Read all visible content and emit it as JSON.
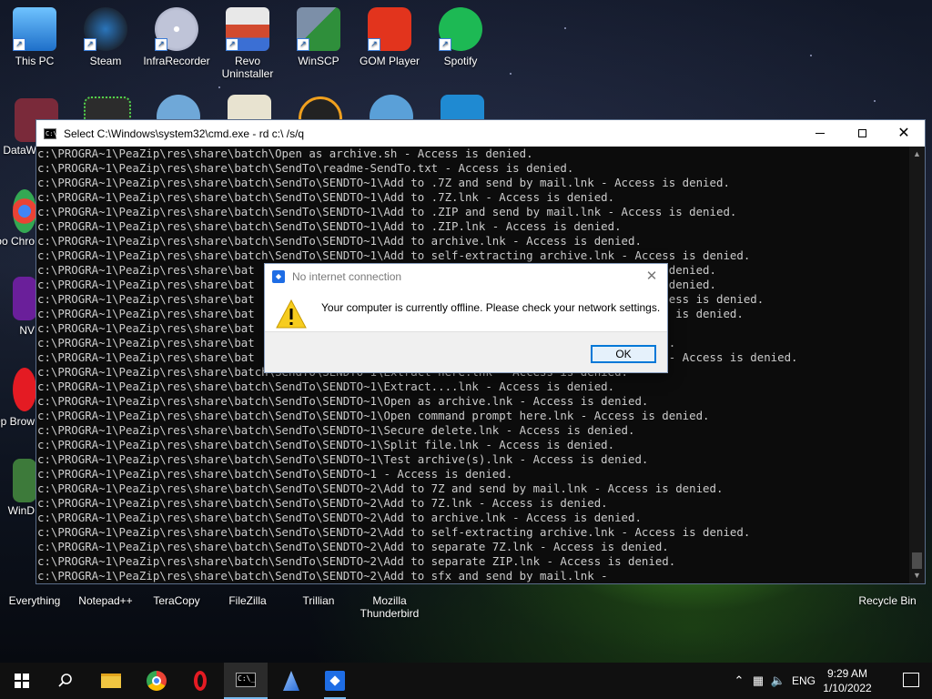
{
  "desktop": {
    "top_icons": [
      {
        "label": "This PC",
        "icon": "computer-icon",
        "color": "#3aa0e6"
      },
      {
        "label": "Steam",
        "icon": "steam-icon",
        "color": "#1b2838"
      },
      {
        "label": "InfraRecorder",
        "icon": "cd-icon",
        "color": "#c8c8d6"
      },
      {
        "label": "Revo Uninstaller",
        "icon": "uninstaller-icon",
        "color": "#d24a2f"
      },
      {
        "label": "WinSCP",
        "icon": "winscp-icon",
        "color": "#2f8f3b"
      },
      {
        "label": "GOM Player",
        "icon": "gom-player-icon",
        "color": "#e2341d"
      },
      {
        "label": "Spotify",
        "icon": "spotify-icon",
        "color": "#1db954"
      }
    ],
    "left_icons_partial": [
      "DataW",
      "Goo Chro",
      "NV",
      "Op Brow",
      "WinD"
    ],
    "bottom_icons": [
      {
        "label": "Everything",
        "icon": "search-app-icon"
      },
      {
        "label": "Notepad++",
        "icon": "notepad-icon"
      },
      {
        "label": "TeraCopy",
        "icon": "teracopy-icon"
      },
      {
        "label": "FileZilla",
        "icon": "filezilla-icon"
      },
      {
        "label": "Trillian",
        "icon": "trillian-icon"
      },
      {
        "label": "Mozilla Thunderbird",
        "icon": "thunderbird-icon"
      }
    ],
    "recycle_bin": "Recycle Bin"
  },
  "console": {
    "title": "Select C:\\Windows\\system32\\cmd.exe - rd  c:\\ /s/q",
    "lines": [
      "c:\\PROGRA~1\\PeaZip\\res\\share\\batch\\Open as archive.sh - Access is denied.",
      "c:\\PROGRA~1\\PeaZip\\res\\share\\batch\\SendTo\\readme-SendTo.txt - Access is denied.",
      "c:\\PROGRA~1\\PeaZip\\res\\share\\batch\\SendTo\\SENDTO~1\\Add to .7Z and send by mail.lnk - Access is denied.",
      "c:\\PROGRA~1\\PeaZip\\res\\share\\batch\\SendTo\\SENDTO~1\\Add to .7Z.lnk - Access is denied.",
      "c:\\PROGRA~1\\PeaZip\\res\\share\\batch\\SendTo\\SENDTO~1\\Add to .ZIP and send by mail.lnk - Access is denied.",
      "c:\\PROGRA~1\\PeaZip\\res\\share\\batch\\SendTo\\SENDTO~1\\Add to .ZIP.lnk - Access is denied.",
      "c:\\PROGRA~1\\PeaZip\\res\\share\\batch\\SendTo\\SENDTO~1\\Add to archive.lnk - Access is denied.",
      "c:\\PROGRA~1\\PeaZip\\res\\share\\batch\\SendTo\\SENDTO~1\\Add to self-extracting archive.lnk - Access is denied.",
      "c:\\PROGRA~1\\PeaZip\\res\\share\\bat                                                             denied.",
      "c:\\PROGRA~1\\PeaZip\\res\\share\\bat                                                             denied.",
      "c:\\PROGRA~1\\PeaZip\\res\\share\\bat                                                             ess is denied.",
      "c:\\PROGRA~1\\PeaZip\\res\\share\\bat                                                              is denied.",
      "c:\\PROGRA~1\\PeaZip\\res\\share\\bat",
      "c:\\PROGRA~1\\PeaZip\\res\\share\\bat                                                             .",
      "c:\\PROGRA~1\\PeaZip\\res\\share\\bat                                                             - Access is denied.",
      "c:\\PROGRA~1\\PeaZip\\res\\share\\batch\\SendTo\\SENDTO~1\\Extract here.lnk - Access is denied.",
      "c:\\PROGRA~1\\PeaZip\\res\\share\\batch\\SendTo\\SENDTO~1\\Extract....lnk - Access is denied.",
      "c:\\PROGRA~1\\PeaZip\\res\\share\\batch\\SendTo\\SENDTO~1\\Open as archive.lnk - Access is denied.",
      "c:\\PROGRA~1\\PeaZip\\res\\share\\batch\\SendTo\\SENDTO~1\\Open command prompt here.lnk - Access is denied.",
      "c:\\PROGRA~1\\PeaZip\\res\\share\\batch\\SendTo\\SENDTO~1\\Secure delete.lnk - Access is denied.",
      "c:\\PROGRA~1\\PeaZip\\res\\share\\batch\\SendTo\\SENDTO~1\\Split file.lnk - Access is denied.",
      "c:\\PROGRA~1\\PeaZip\\res\\share\\batch\\SendTo\\SENDTO~1\\Test archive(s).lnk - Access is denied.",
      "c:\\PROGRA~1\\PeaZip\\res\\share\\batch\\SendTo\\SENDTO~1 - Access is denied.",
      "c:\\PROGRA~1\\PeaZip\\res\\share\\batch\\SendTo\\SENDTO~2\\Add to 7Z and send by mail.lnk - Access is denied.",
      "c:\\PROGRA~1\\PeaZip\\res\\share\\batch\\SendTo\\SENDTO~2\\Add to 7Z.lnk - Access is denied.",
      "c:\\PROGRA~1\\PeaZip\\res\\share\\batch\\SendTo\\SENDTO~2\\Add to archive.lnk - Access is denied.",
      "c:\\PROGRA~1\\PeaZip\\res\\share\\batch\\SendTo\\SENDTO~2\\Add to self-extracting archive.lnk - Access is denied.",
      "c:\\PROGRA~1\\PeaZip\\res\\share\\batch\\SendTo\\SENDTO~2\\Add to separate 7Z.lnk - Access is denied.",
      "c:\\PROGRA~1\\PeaZip\\res\\share\\batch\\SendTo\\SENDTO~2\\Add to separate ZIP.lnk - Access is denied.",
      "c:\\PROGRA~1\\PeaZip\\res\\share\\batch\\SendTo\\SENDTO~2\\Add to sfx and send by mail.lnk -"
    ]
  },
  "dialog": {
    "title": "No internet connection",
    "message": "Your computer is currently offline. Please check your network settings.",
    "ok_label": "OK",
    "title_icon": "dropbox-icon",
    "body_icon": "warning-icon"
  },
  "taskbar": {
    "pinned": [
      "start-icon",
      "search-icon",
      "file-explorer-icon",
      "chrome-icon",
      "opera-icon",
      "cmd-icon",
      "app-icon",
      "dropbox-icon"
    ],
    "language": "ENG",
    "time": "9:29 AM",
    "date": "1/10/2022"
  },
  "colors": {
    "console_bg": "#0c0c0c",
    "console_text": "#cccccc",
    "accent": "#0078d7",
    "taskbar_bg": "#101010"
  }
}
